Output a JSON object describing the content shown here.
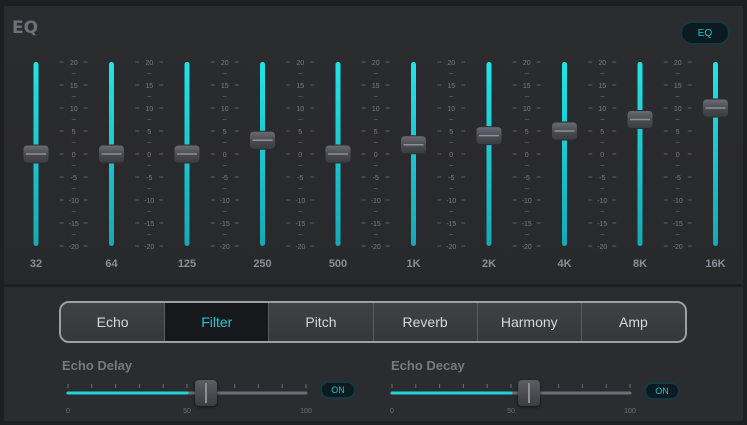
{
  "eq": {
    "title": "EQ",
    "toggle_label": "EQ",
    "scale_labels": [
      "20",
      "15",
      "10",
      "5",
      "0",
      "-5",
      "-10",
      "-15",
      "-20"
    ],
    "bands": [
      {
        "label": "32",
        "gain": 0
      },
      {
        "label": "64",
        "gain": 0
      },
      {
        "label": "125",
        "gain": 0
      },
      {
        "label": "250",
        "gain": 3
      },
      {
        "label": "500",
        "gain": 0
      },
      {
        "label": "1K",
        "gain": 2
      },
      {
        "label": "2K",
        "gain": 4
      },
      {
        "label": "4K",
        "gain": 5
      },
      {
        "label": "8K",
        "gain": 7.5
      },
      {
        "label": "16K",
        "gain": 10
      }
    ],
    "accent_color": "#1fd3d8"
  },
  "effects": {
    "tabs": [
      "Echo",
      "Filter",
      "Pitch",
      "Reverb",
      "Harmony",
      "Amp"
    ],
    "active_tab": "Filter",
    "controls": [
      {
        "label": "Echo Delay",
        "value": 50,
        "min_label": "0",
        "mid_label": "50",
        "max_label": "100",
        "toggle": "ON"
      },
      {
        "label": "Echo Decay",
        "value": 50,
        "min_label": "0",
        "mid_label": "50",
        "max_label": "100",
        "toggle": "ON"
      }
    ]
  }
}
